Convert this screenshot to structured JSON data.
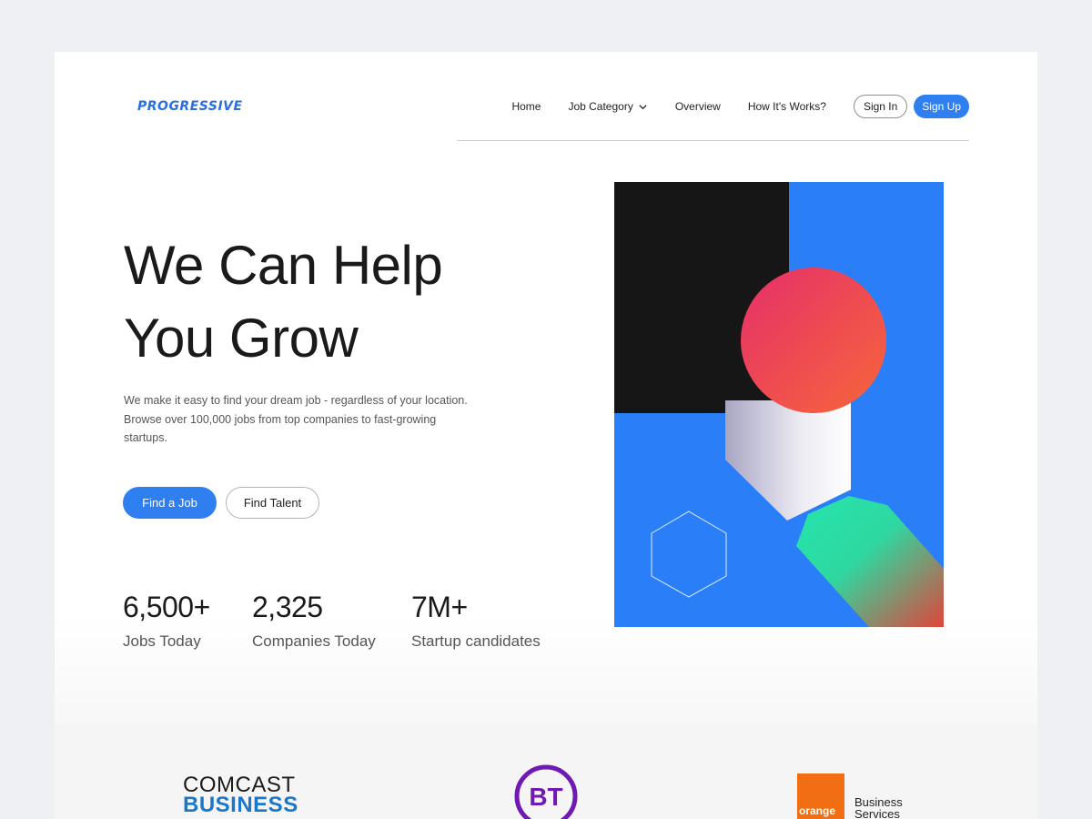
{
  "brand": {
    "logo_text": "PROGRESSIVE",
    "accent": "#2f7ff0"
  },
  "nav": {
    "items": [
      {
        "label": "Home"
      },
      {
        "label": "Job Category",
        "icon": "chevron-down-icon"
      },
      {
        "label": "Overview"
      },
      {
        "label": "How It's Works?"
      }
    ],
    "signin_label": "Sign In",
    "signup_label": "Sign Up"
  },
  "hero": {
    "title_line1": "We Can Help",
    "title_line2": "You Grow",
    "description": "We make it easy to find your dream job - regardless of your location. Browse over 100,000 jobs from top companies to fast-growing startups.",
    "primary_cta": "Find a Job",
    "secondary_cta": "Find Talent"
  },
  "stats": [
    {
      "value": "6,500+",
      "label": "Jobs Today"
    },
    {
      "value": "2,325",
      "label": "Companies Today"
    },
    {
      "value": "7M+",
      "label": "Startup candidates"
    }
  ],
  "partners": {
    "comcast_line1": "COMCAST",
    "comcast_line2": "BUSINESS",
    "bt": "BT",
    "orange_box": "orange",
    "orange_line1": "Business",
    "orange_line2": "Services"
  },
  "colors": {
    "illustration_blue": "#2a7ff8",
    "illustration_black": "#161616",
    "circle_gradient": [
      "#e62f6a",
      "#f6663a"
    ],
    "green_gradient": [
      "#23e6ad",
      "#e0453a"
    ],
    "bt_purple": "#6f1ab3",
    "orange_brand": "#f26e12"
  }
}
